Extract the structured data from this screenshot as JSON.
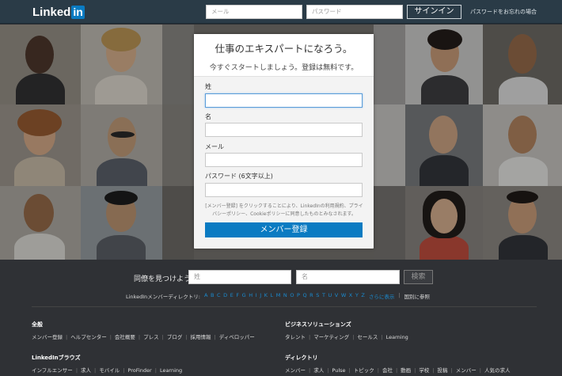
{
  "header": {
    "logo_text": "Linked",
    "logo_in": "in",
    "email_placeholder": "メール",
    "password_placeholder": "パスワード",
    "signin_label": "サインイン",
    "forgot_label": "パスワードをお忘れの場合"
  },
  "signup": {
    "title": "仕事のエキスパートになろう。",
    "subtitle": "今すぐスタートしましょう。登録は無料です。",
    "first_name_label": "姓",
    "last_name_label": "名",
    "email_label": "メール",
    "password_label": "パスワード (6文字以上)",
    "terms": "[メンバー登録] をクリックすることにより、LinkedInの利用規約、プライバシーポリシー、Cookieポリシーに同意したものとみなされます。",
    "join_label": "メンバー登録"
  },
  "find": {
    "label": "同僚を見つけよう",
    "first_placeholder": "姓",
    "last_placeholder": "名",
    "search_label": "検索"
  },
  "directory": {
    "label": "LinkedInメンバーディレクトリ:",
    "letters": "A B C D E F G H I J K L M N O P Q R S T U V W X Y Z",
    "more": "さらに表示",
    "country": "国別に参照"
  },
  "footer": {
    "general": {
      "title": "全般",
      "links": [
        "メンバー登録",
        "ヘルプセンター",
        "会社概要",
        "プレス",
        "ブログ",
        "採用情報",
        "ディベロッパー"
      ]
    },
    "business": {
      "title": "ビジネスソリューションズ",
      "links": [
        "タレント",
        "マーケティング",
        "セールス",
        "Learning"
      ]
    },
    "browse": {
      "title": "LinkedInブラウズ",
      "links": [
        "インフルエンサー",
        "求人",
        "モバイル",
        "ProFinder",
        "Learning"
      ]
    },
    "directories": {
      "title": "ディレクトリ",
      "links": [
        "メンバー",
        "求人",
        "Pulse",
        "トピック",
        "会社",
        "動画",
        "学校",
        "投稿",
        "メンバー",
        "人気の求人"
      ]
    }
  },
  "colors": {
    "header_bg": "#2a3b47",
    "brand_blue": "#0a7bc2",
    "page_bg": "#2f3135",
    "link_blue": "#1a8bd0"
  }
}
